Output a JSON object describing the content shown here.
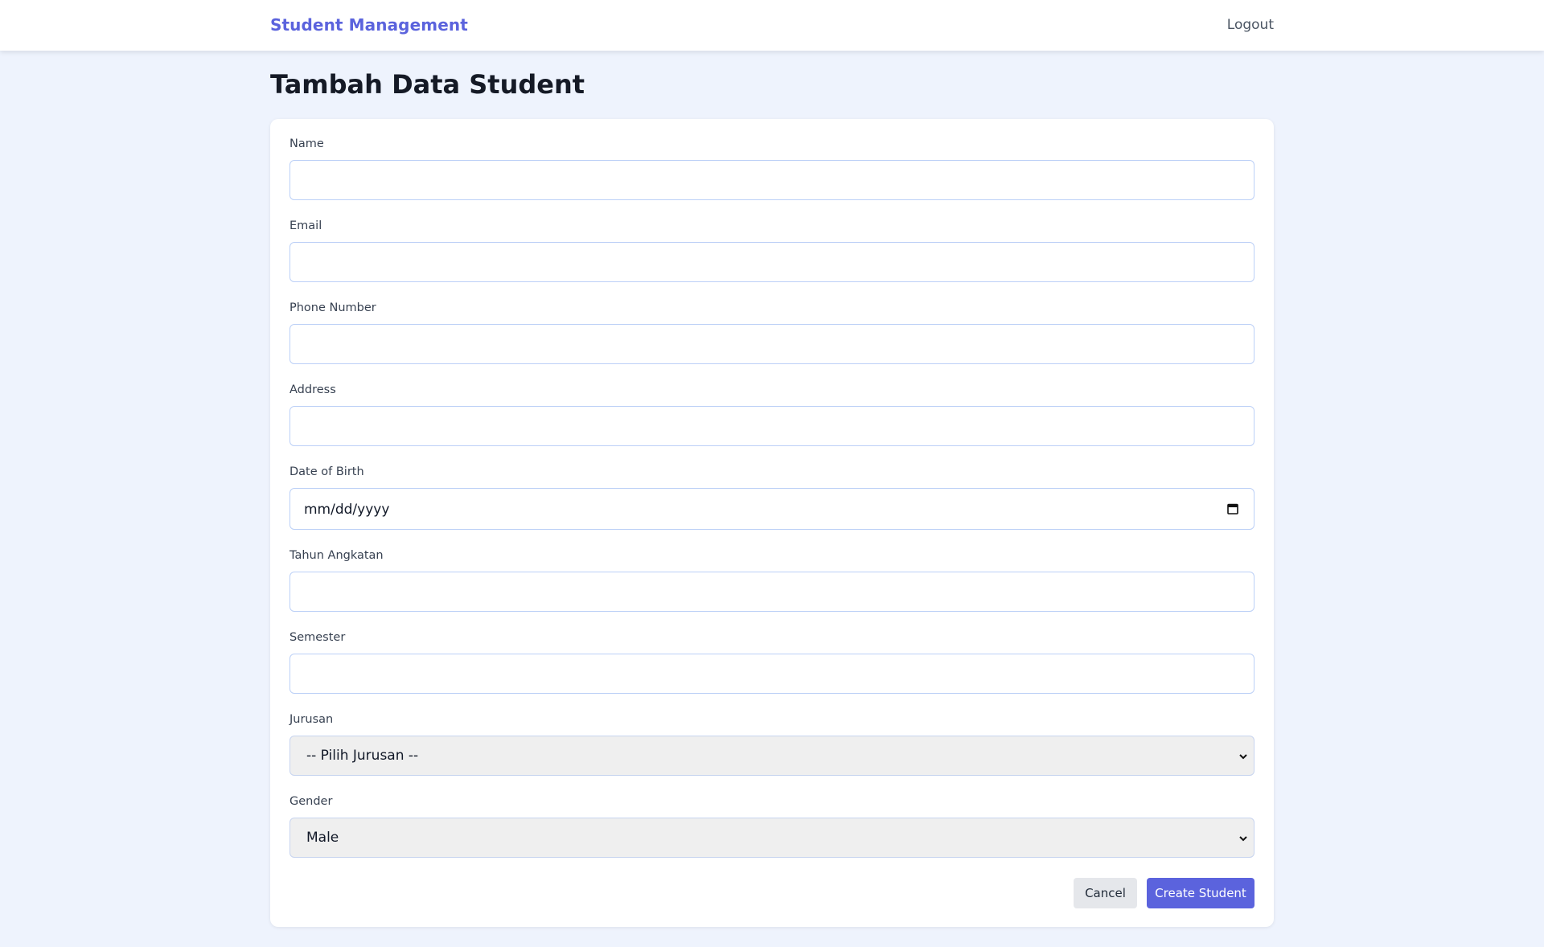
{
  "navbar": {
    "brand": "Student Management",
    "logout_label": "Logout"
  },
  "page": {
    "title": "Tambah Data Student"
  },
  "form": {
    "name": {
      "label": "Name",
      "value": ""
    },
    "email": {
      "label": "Email",
      "value": ""
    },
    "phone": {
      "label": "Phone Number",
      "value": ""
    },
    "address": {
      "label": "Address",
      "value": ""
    },
    "dob": {
      "label": "Date of Birth",
      "placeholder": "mm/dd/yyyy"
    },
    "tahun_angkatan": {
      "label": "Tahun Angkatan",
      "value": ""
    },
    "semester": {
      "label": "Semester",
      "value": ""
    },
    "jurusan": {
      "label": "Jurusan",
      "selected": "-- Pilih Jurusan --"
    },
    "gender": {
      "label": "Gender",
      "selected": "Male"
    },
    "cancel_label": "Cancel",
    "submit_label": "Create Student"
  },
  "icons": {
    "date_picker": "calendar-icon",
    "select_arrow": "chevron-down-icon"
  },
  "colors": {
    "brand": "#5b63dd",
    "page_background": "#eef3fd",
    "input_border": "#bcd0f7",
    "select_background": "#efefef",
    "cancel_background": "#e5e7eb",
    "submit_background": "#5b63dd"
  }
}
